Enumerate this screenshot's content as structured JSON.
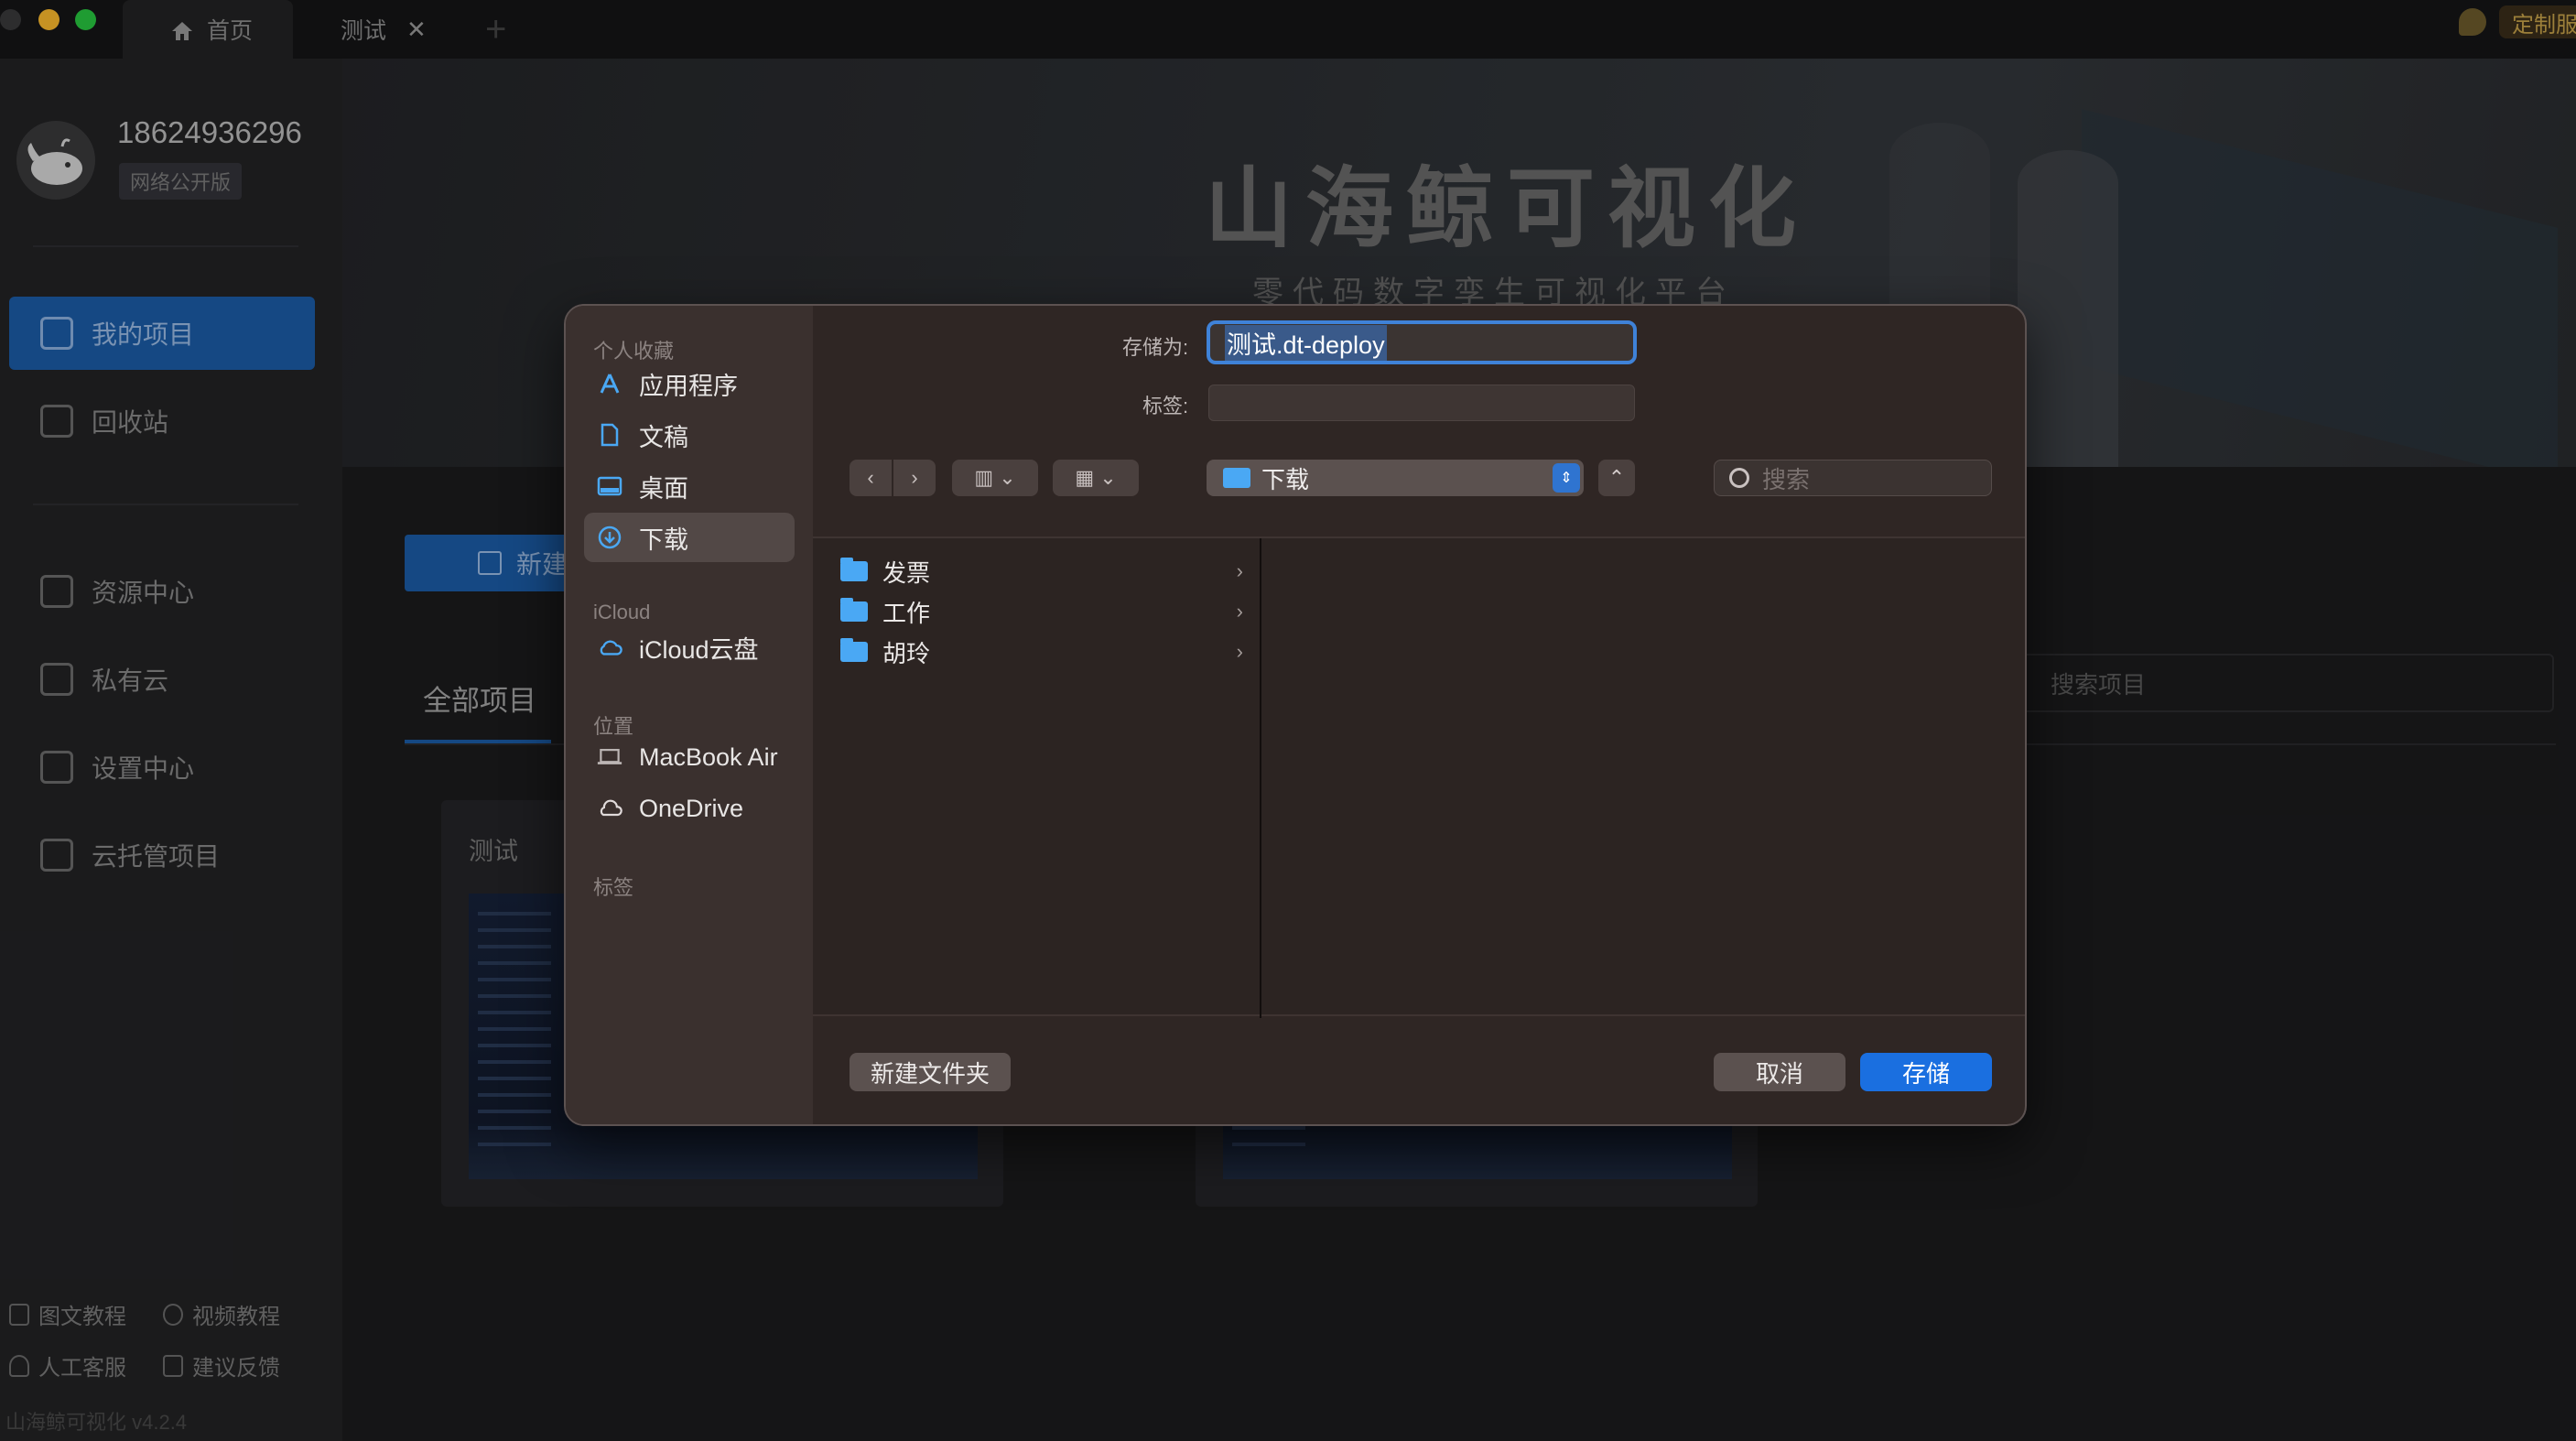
{
  "titlebar": {
    "tabs": [
      {
        "label": "首页",
        "icon": "home-icon"
      },
      {
        "label": "测试",
        "close": "✕"
      }
    ],
    "add_tab": "+",
    "custom_service": "定制服务"
  },
  "sidebar": {
    "username": "18624936296",
    "edition": "网络公开版",
    "nav": [
      {
        "label": "我的项目",
        "icon": "project-icon",
        "active": true
      },
      {
        "label": "回收站",
        "icon": "trash-icon"
      },
      {
        "label": "资源中心",
        "icon": "resource-icon"
      },
      {
        "label": "私有云",
        "icon": "private-cloud-icon"
      },
      {
        "label": "设置中心",
        "icon": "settings-icon"
      },
      {
        "label": "云托管项目",
        "icon": "cloud-hosting-icon"
      }
    ],
    "footer_links": [
      {
        "label": "图文教程",
        "icon": "book-icon"
      },
      {
        "label": "视频教程",
        "icon": "play-icon"
      },
      {
        "label": "人工客服",
        "icon": "person-icon"
      },
      {
        "label": "建议反馈",
        "icon": "feedback-icon"
      }
    ],
    "version": "山海鲸可视化 v4.2.4"
  },
  "main": {
    "banner_title": "山海鲸可视化",
    "banner_subtitle": "零代码数字孪生可视化平台",
    "new_button": "新建",
    "tab_all": "全部项目",
    "search_placeholder": "搜索项目",
    "cards": [
      {
        "title": "测试"
      },
      {
        "title": ""
      }
    ]
  },
  "dialog": {
    "save_as_label": "存储为:",
    "filename": "测试.dt-deploy",
    "tags_label": "标签:",
    "sidebar": {
      "favorites_header": "个人收藏",
      "favorites": [
        {
          "label": "应用程序",
          "icon": "applications-icon"
        },
        {
          "label": "文稿",
          "icon": "document-icon"
        },
        {
          "label": "桌面",
          "icon": "desktop-icon"
        },
        {
          "label": "下载",
          "icon": "download-icon",
          "active": true
        }
      ],
      "icloud_header": "iCloud",
      "icloud": [
        {
          "label": "iCloud云盘",
          "icon": "icloud-icon"
        }
      ],
      "locations_header": "位置",
      "locations": [
        {
          "label": "MacBook Air",
          "icon": "laptop-icon"
        },
        {
          "label": "OneDrive",
          "icon": "onedrive-icon"
        }
      ],
      "tags_header": "标签"
    },
    "location": "下载",
    "search_placeholder": "搜索",
    "folders": [
      "发票",
      "工作",
      "胡玲"
    ],
    "buttons": {
      "new_folder": "新建文件夹",
      "cancel": "取消",
      "save": "存储"
    },
    "colors": {
      "accent": "#1a6fe0",
      "folder": "#4aa8f4"
    }
  }
}
